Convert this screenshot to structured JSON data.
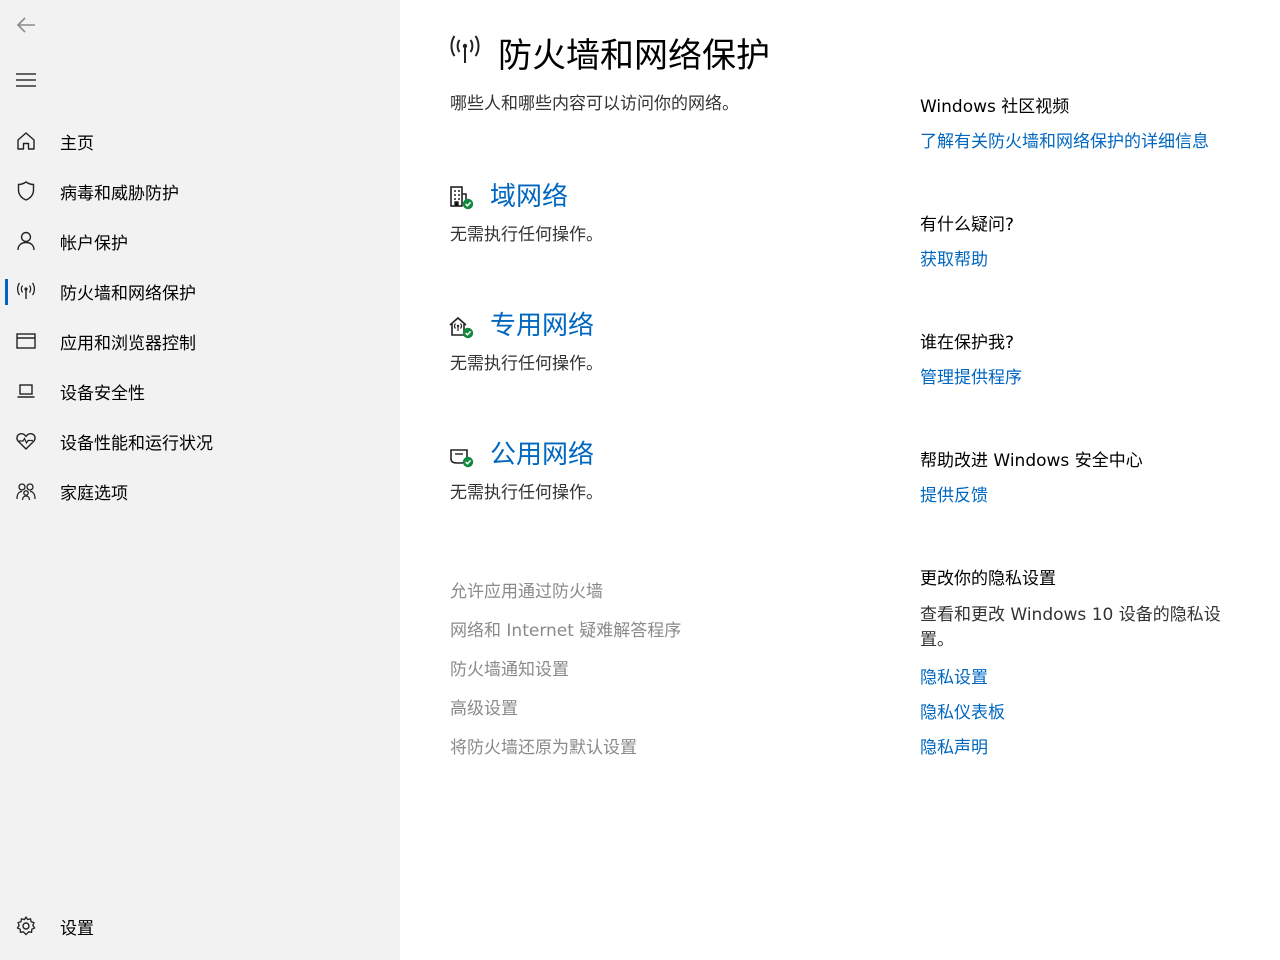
{
  "sidebar": {
    "items": [
      {
        "label": "主页",
        "icon": "home-icon"
      },
      {
        "label": "病毒和威胁防护",
        "icon": "shield-icon"
      },
      {
        "label": "帐户保护",
        "icon": "person-icon"
      },
      {
        "label": "防火墙和网络保护",
        "icon": "antenna-icon",
        "selected": true
      },
      {
        "label": "应用和浏览器控制",
        "icon": "window-icon"
      },
      {
        "label": "设备安全性",
        "icon": "laptop-icon"
      },
      {
        "label": "设备性能和运行状况",
        "icon": "heart-icon"
      },
      {
        "label": "家庭选项",
        "icon": "family-icon"
      }
    ],
    "settings_label": "设置"
  },
  "main": {
    "title": "防火墙和网络保护",
    "subtitle": "哪些人和哪些内容可以访问你的网络。",
    "networks": [
      {
        "name": "域网络",
        "status": "无需执行任何操作。",
        "icon": "domain-network-icon"
      },
      {
        "name": "专用网络",
        "status": "无需执行任何操作。",
        "icon": "private-network-icon"
      },
      {
        "name": "公用网络",
        "status": "无需执行任何操作。",
        "icon": "public-network-icon"
      }
    ],
    "links": [
      "允许应用通过防火墙",
      "网络和 Internet 疑难解答程序",
      "防火墙通知设置",
      "高级设置",
      "将防火墙还原为默认设置"
    ]
  },
  "right": {
    "community": {
      "heading": "Windows 社区视频",
      "link": "了解有关防火墙和网络保护的详细信息"
    },
    "question": {
      "heading": "有什么疑问?",
      "link": "获取帮助"
    },
    "protect": {
      "heading": "谁在保护我?",
      "link": "管理提供程序"
    },
    "improve": {
      "heading": "帮助改进 Windows 安全中心",
      "link": "提供反馈"
    },
    "privacy": {
      "heading": "更改你的隐私设置",
      "text": "查看和更改 Windows 10 设备的隐私设置。",
      "links": [
        "隐私设置",
        "隐私仪表板",
        "隐私声明"
      ]
    }
  },
  "colors": {
    "accent": "#0067c0",
    "status_ok": "#10893e",
    "sidebar_bg": "#f2f2f2"
  }
}
